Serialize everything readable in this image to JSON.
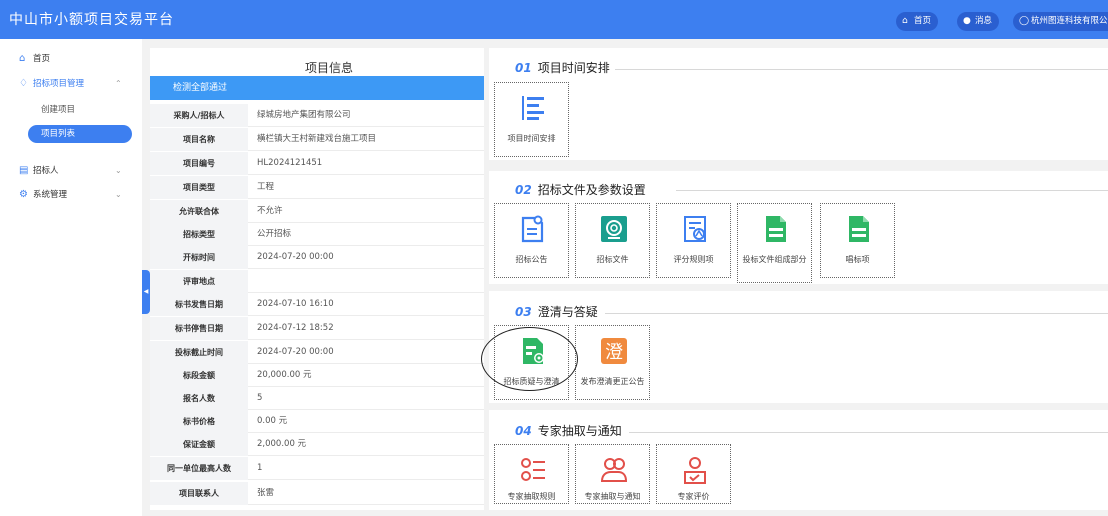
{
  "header": {
    "logo": "中山市小额项目交易平台",
    "nav": [
      {
        "icon": "home-icon",
        "label": "首页"
      },
      {
        "icon": "bell-icon",
        "label": "消息"
      },
      {
        "icon": "user-icon",
        "label": "杭州图连科技有限公司"
      }
    ]
  },
  "sidebar": {
    "home": "首页",
    "tender_mgmt": "招标项目管理",
    "create_project": "创建项目",
    "project_list": "项目列表",
    "tenderer": "招标人",
    "system_mgmt": "系统管理"
  },
  "info": {
    "title": "项目信息",
    "status": "检测全部通过",
    "rows": [
      {
        "label": "采购人/招标人",
        "value": "绿城房地产集团有限公司"
      },
      {
        "label": "项目名称",
        "value": "横栏镇大王村新建戏台施工项目"
      },
      {
        "label": "项目编号",
        "value": "HL2024121451"
      },
      {
        "label": "项目类型",
        "value": "工程"
      },
      {
        "label": "允许联合体",
        "value": "不允许"
      },
      {
        "label": "招标类型",
        "value": "公开招标"
      },
      {
        "label": "开标时间",
        "value": "2024-07-20 00:00"
      },
      {
        "label": "评审地点",
        "value": ""
      },
      {
        "label": "标书发售日期",
        "value": "2024-07-10 16:10"
      },
      {
        "label": "标书停售日期",
        "value": "2024-07-12 18:52"
      },
      {
        "label": "投标截止时间",
        "value": "2024-07-20 00:00"
      },
      {
        "label": "标段金额",
        "value": "20,000.00 元"
      },
      {
        "label": "报名人数",
        "value": "5"
      },
      {
        "label": "标书价格",
        "value": "0.00 元"
      },
      {
        "label": "保证金额",
        "value": "2,000.00 元"
      },
      {
        "label": "同一单位最高人数",
        "value": "1"
      },
      {
        "label": "项目联系人",
        "value": "张雷"
      }
    ]
  },
  "sections": [
    {
      "num": "01",
      "title": "项目时间安排",
      "tiles": [
        {
          "icon": "timeline-list-icon",
          "label": "项目时间安排"
        }
      ]
    },
    {
      "num": "02",
      "title": "招标文件及参数设置",
      "tiles": [
        {
          "icon": "announcement-doc-icon",
          "label": "招标公告"
        },
        {
          "icon": "tender-file-icon",
          "label": "招标文件"
        },
        {
          "icon": "scoring-rules-icon",
          "label": "评分规则项"
        },
        {
          "icon": "bid-doc-parts-icon",
          "label": "投标文件组成部分"
        },
        {
          "icon": "bid-item-icon",
          "label": "唱标项"
        }
      ]
    },
    {
      "num": "03",
      "title": "澄清与答疑",
      "tiles": [
        {
          "icon": "qa-clarify-icon",
          "label": "招标质疑与澄清"
        },
        {
          "icon": "publish-correction-icon",
          "label": "发布澄清更正公告"
        }
      ]
    },
    {
      "num": "04",
      "title": "专家抽取与通知",
      "tiles": [
        {
          "icon": "expert-rules-icon",
          "label": "专家抽取规则"
        },
        {
          "icon": "expert-notify-icon",
          "label": "专家抽取与通知"
        },
        {
          "icon": "expert-review-icon",
          "label": "专家评价"
        }
      ]
    }
  ],
  "icons": {
    "correction_glyph": "澄"
  },
  "colors": {
    "brand": "#3d7ff0",
    "status": "#3d99f5",
    "green": "#2fb765",
    "teal": "#1a9e8e",
    "orange": "#f08a3e",
    "red": "#e2504a"
  }
}
